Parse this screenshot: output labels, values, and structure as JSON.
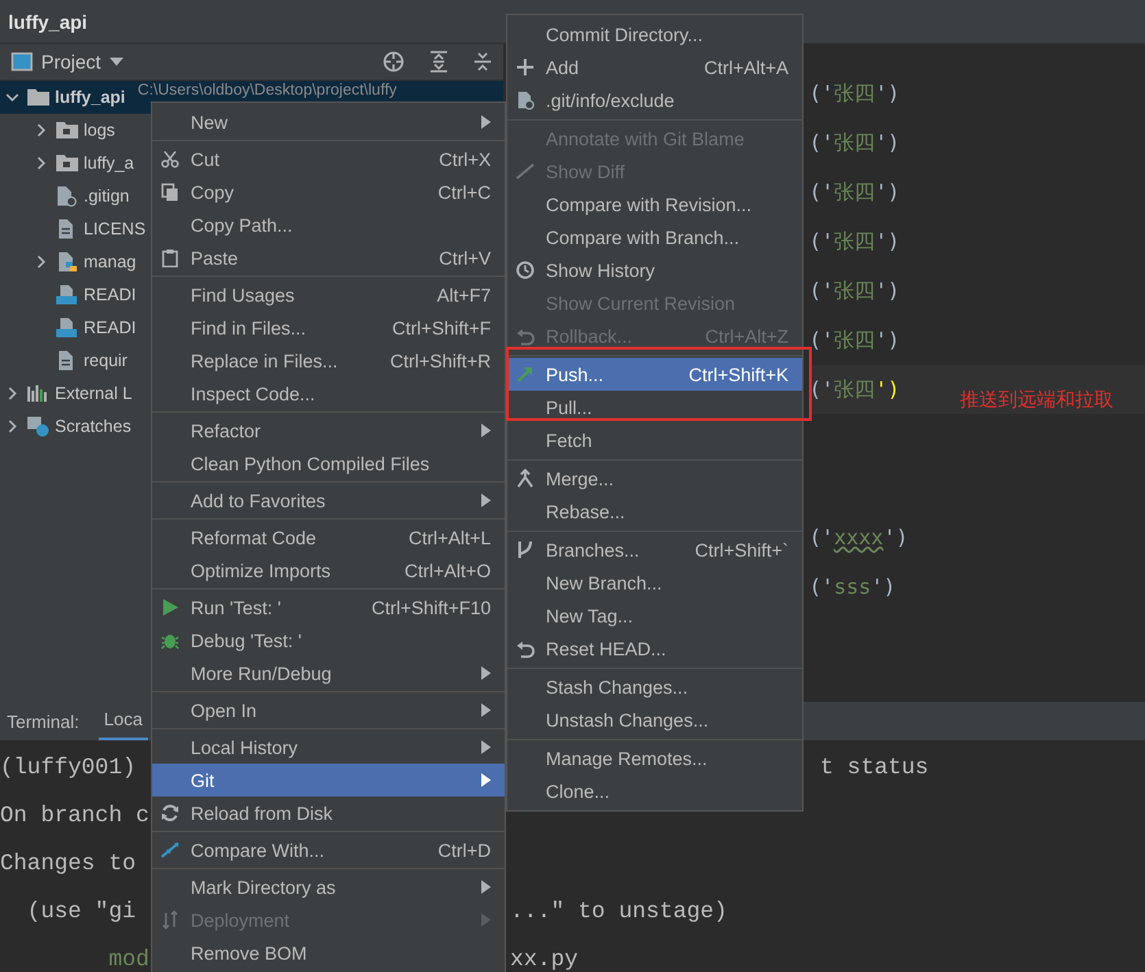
{
  "window": {
    "title": "luffy_api"
  },
  "project_panel": {
    "title": "Project",
    "tree": [
      {
        "kind": "folder",
        "label": "luffy_api",
        "path": "C:\\Users\\oldboy\\Desktop\\project\\luffy",
        "expanded": true,
        "selected": true,
        "children": [
          {
            "kind": "folder",
            "label": "logs",
            "expanded": false,
            "selected": false
          },
          {
            "kind": "folder",
            "label": "luffy_a",
            "expanded": false,
            "selected": false
          },
          {
            "kind": "ignore-file",
            "label": ".gitign",
            "selected": false
          },
          {
            "kind": "text-file",
            "label": "LICENS",
            "selected": false
          },
          {
            "kind": "python-file",
            "label": "manag",
            "expanded": false,
            "selected": false
          },
          {
            "kind": "markdown-file",
            "label": "READI",
            "selected": false
          },
          {
            "kind": "markdown-file",
            "label": "READI",
            "selected": false
          },
          {
            "kind": "text-file",
            "label": "requir",
            "selected": false
          }
        ]
      },
      {
        "kind": "library",
        "label": "External L",
        "expanded": false,
        "selected": false
      },
      {
        "kind": "scratches",
        "label": "Scratches",
        "expanded": false,
        "selected": false
      }
    ]
  },
  "editor": {
    "blocks": [
      {
        "lines": [
          {
            "text": "('张四')",
            "current": false,
            "misspelled": false
          },
          {
            "text": "('张四')",
            "current": false,
            "misspelled": false
          },
          {
            "text": "('张四')",
            "current": false,
            "misspelled": false
          },
          {
            "text": "('张四')",
            "current": false,
            "misspelled": false
          },
          {
            "text": "('张四')",
            "current": false,
            "misspelled": false
          },
          {
            "text": "('张四')",
            "current": false,
            "misspelled": false
          },
          {
            "text": "('张四')",
            "current": true,
            "misspelled": false
          }
        ]
      },
      {
        "lines": [
          {
            "text": "('xxxx')",
            "current": false,
            "misspelled": true
          },
          {
            "text": "('sss')",
            "current": false,
            "misspelled": false
          }
        ]
      }
    ]
  },
  "annotation": {
    "text": "推送到远端和拉取"
  },
  "terminal": {
    "title": "Terminal:",
    "tabs": [
      {
        "label": "Loca",
        "selected": true
      }
    ],
    "lines": [
      {
        "left": "(luffy001)",
        "right": "t status"
      },
      {
        "left": "On branch c"
      },
      {
        "left": "Changes to"
      },
      {
        "left": "  (use \"gi",
        "right": "...\" to unstage)"
      },
      {
        "left": "        mod",
        "right": "xx.py"
      }
    ]
  },
  "context_menu": {
    "items": [
      {
        "kind": "item",
        "label": "New",
        "submenu": true,
        "selected": false,
        "disabled": false
      },
      {
        "kind": "separator"
      },
      {
        "kind": "item",
        "label": "Cut",
        "shortcut": "Ctrl+X",
        "submenu": false,
        "selected": false,
        "disabled": false
      },
      {
        "kind": "item",
        "label": "Copy",
        "shortcut": "Ctrl+C",
        "submenu": false,
        "selected": false,
        "disabled": false
      },
      {
        "kind": "item",
        "label": "Copy Path...",
        "submenu": false,
        "selected": false,
        "disabled": false
      },
      {
        "kind": "item",
        "label": "Paste",
        "shortcut": "Ctrl+V",
        "submenu": false,
        "selected": false,
        "disabled": false
      },
      {
        "kind": "separator"
      },
      {
        "kind": "item",
        "label": "Find Usages",
        "shortcut": "Alt+F7",
        "submenu": false,
        "selected": false,
        "disabled": false
      },
      {
        "kind": "item",
        "label": "Find in Files...",
        "shortcut": "Ctrl+Shift+F",
        "submenu": false,
        "selected": false,
        "disabled": false
      },
      {
        "kind": "item",
        "label": "Replace in Files...",
        "shortcut": "Ctrl+Shift+R",
        "submenu": false,
        "selected": false,
        "disabled": false
      },
      {
        "kind": "item",
        "label": "Inspect Code...",
        "submenu": false,
        "selected": false,
        "disabled": false
      },
      {
        "kind": "separator"
      },
      {
        "kind": "item",
        "label": "Refactor",
        "submenu": true,
        "selected": false,
        "disabled": false
      },
      {
        "kind": "item",
        "label": "Clean Python Compiled Files",
        "submenu": false,
        "selected": false,
        "disabled": false
      },
      {
        "kind": "separator"
      },
      {
        "kind": "item",
        "label": "Add to Favorites",
        "submenu": true,
        "selected": false,
        "disabled": false
      },
      {
        "kind": "separator"
      },
      {
        "kind": "item",
        "label": "Reformat Code",
        "shortcut": "Ctrl+Alt+L",
        "submenu": false,
        "selected": false,
        "disabled": false
      },
      {
        "kind": "item",
        "label": "Optimize Imports",
        "shortcut": "Ctrl+Alt+O",
        "submenu": false,
        "selected": false,
        "disabled": false
      },
      {
        "kind": "separator"
      },
      {
        "kind": "item",
        "label": "Run 'Test: '",
        "shortcut": "Ctrl+Shift+F10",
        "submenu": false,
        "selected": false,
        "disabled": false
      },
      {
        "kind": "item",
        "label": "Debug 'Test: '",
        "submenu": false,
        "selected": false,
        "disabled": false
      },
      {
        "kind": "item",
        "label": "More Run/Debug",
        "submenu": true,
        "selected": false,
        "disabled": false
      },
      {
        "kind": "separator"
      },
      {
        "kind": "item",
        "label": "Open In",
        "submenu": true,
        "selected": false,
        "disabled": false
      },
      {
        "kind": "separator"
      },
      {
        "kind": "item",
        "label": "Local History",
        "submenu": true,
        "selected": false,
        "disabled": false
      },
      {
        "kind": "item",
        "label": "Git",
        "submenu": true,
        "selected": true,
        "disabled": false
      },
      {
        "kind": "item",
        "label": "Reload from Disk",
        "submenu": false,
        "selected": false,
        "disabled": false
      },
      {
        "kind": "separator"
      },
      {
        "kind": "item",
        "label": "Compare With...",
        "shortcut": "Ctrl+D",
        "submenu": false,
        "selected": false,
        "disabled": false
      },
      {
        "kind": "separator"
      },
      {
        "kind": "item",
        "label": "Mark Directory as",
        "submenu": true,
        "selected": false,
        "disabled": false
      },
      {
        "kind": "item",
        "label": "Deployment",
        "submenu": true,
        "selected": false,
        "disabled": true
      },
      {
        "kind": "item",
        "label": "Remove BOM",
        "submenu": false,
        "selected": false,
        "disabled": false
      }
    ]
  },
  "git_menu": {
    "items": [
      {
        "kind": "item",
        "label": "Commit Directory...",
        "submenu": false,
        "selected": false,
        "disabled": false
      },
      {
        "kind": "item",
        "label": "Add",
        "shortcut": "Ctrl+Alt+A",
        "submenu": false,
        "selected": false,
        "disabled": false
      },
      {
        "kind": "item",
        "label": ".git/info/exclude",
        "submenu": false,
        "selected": false,
        "disabled": false
      },
      {
        "kind": "separator"
      },
      {
        "kind": "item",
        "label": "Annotate with Git Blame",
        "submenu": false,
        "selected": false,
        "disabled": true
      },
      {
        "kind": "item",
        "label": "Show Diff",
        "submenu": false,
        "selected": false,
        "disabled": true
      },
      {
        "kind": "item",
        "label": "Compare with Revision...",
        "submenu": false,
        "selected": false,
        "disabled": false
      },
      {
        "kind": "item",
        "label": "Compare with Branch...",
        "submenu": false,
        "selected": false,
        "disabled": false
      },
      {
        "kind": "item",
        "label": "Show History",
        "submenu": false,
        "selected": false,
        "disabled": false
      },
      {
        "kind": "item",
        "label": "Show Current Revision",
        "submenu": false,
        "selected": false,
        "disabled": true
      },
      {
        "kind": "item",
        "label": "Rollback...",
        "shortcut": "Ctrl+Alt+Z",
        "submenu": false,
        "selected": false,
        "disabled": true
      },
      {
        "kind": "separator"
      },
      {
        "kind": "item",
        "label": "Push...",
        "shortcut": "Ctrl+Shift+K",
        "submenu": false,
        "selected": true,
        "disabled": false
      },
      {
        "kind": "item",
        "label": "Pull...",
        "submenu": false,
        "selected": false,
        "disabled": false
      },
      {
        "kind": "item",
        "label": "Fetch",
        "submenu": false,
        "selected": false,
        "disabled": false
      },
      {
        "kind": "separator"
      },
      {
        "kind": "item",
        "label": "Merge...",
        "submenu": false,
        "selected": false,
        "disabled": false
      },
      {
        "kind": "item",
        "label": "Rebase...",
        "submenu": false,
        "selected": false,
        "disabled": false
      },
      {
        "kind": "separator"
      },
      {
        "kind": "item",
        "label": "Branches...",
        "shortcut": "Ctrl+Shift+`",
        "submenu": false,
        "selected": false,
        "disabled": false
      },
      {
        "kind": "item",
        "label": "New Branch...",
        "submenu": false,
        "selected": false,
        "disabled": false
      },
      {
        "kind": "item",
        "label": "New Tag...",
        "submenu": false,
        "selected": false,
        "disabled": false
      },
      {
        "kind": "item",
        "label": "Reset HEAD...",
        "submenu": false,
        "selected": false,
        "disabled": false
      },
      {
        "kind": "separator"
      },
      {
        "kind": "item",
        "label": "Stash Changes...",
        "submenu": false,
        "selected": false,
        "disabled": false
      },
      {
        "kind": "item",
        "label": "Unstash Changes...",
        "submenu": false,
        "selected": false,
        "disabled": false
      },
      {
        "kind": "separator"
      },
      {
        "kind": "item",
        "label": "Manage Remotes...",
        "submenu": false,
        "selected": false,
        "disabled": false
      },
      {
        "kind": "item",
        "label": "Clone...",
        "submenu": false,
        "selected": false,
        "disabled": false
      }
    ]
  }
}
